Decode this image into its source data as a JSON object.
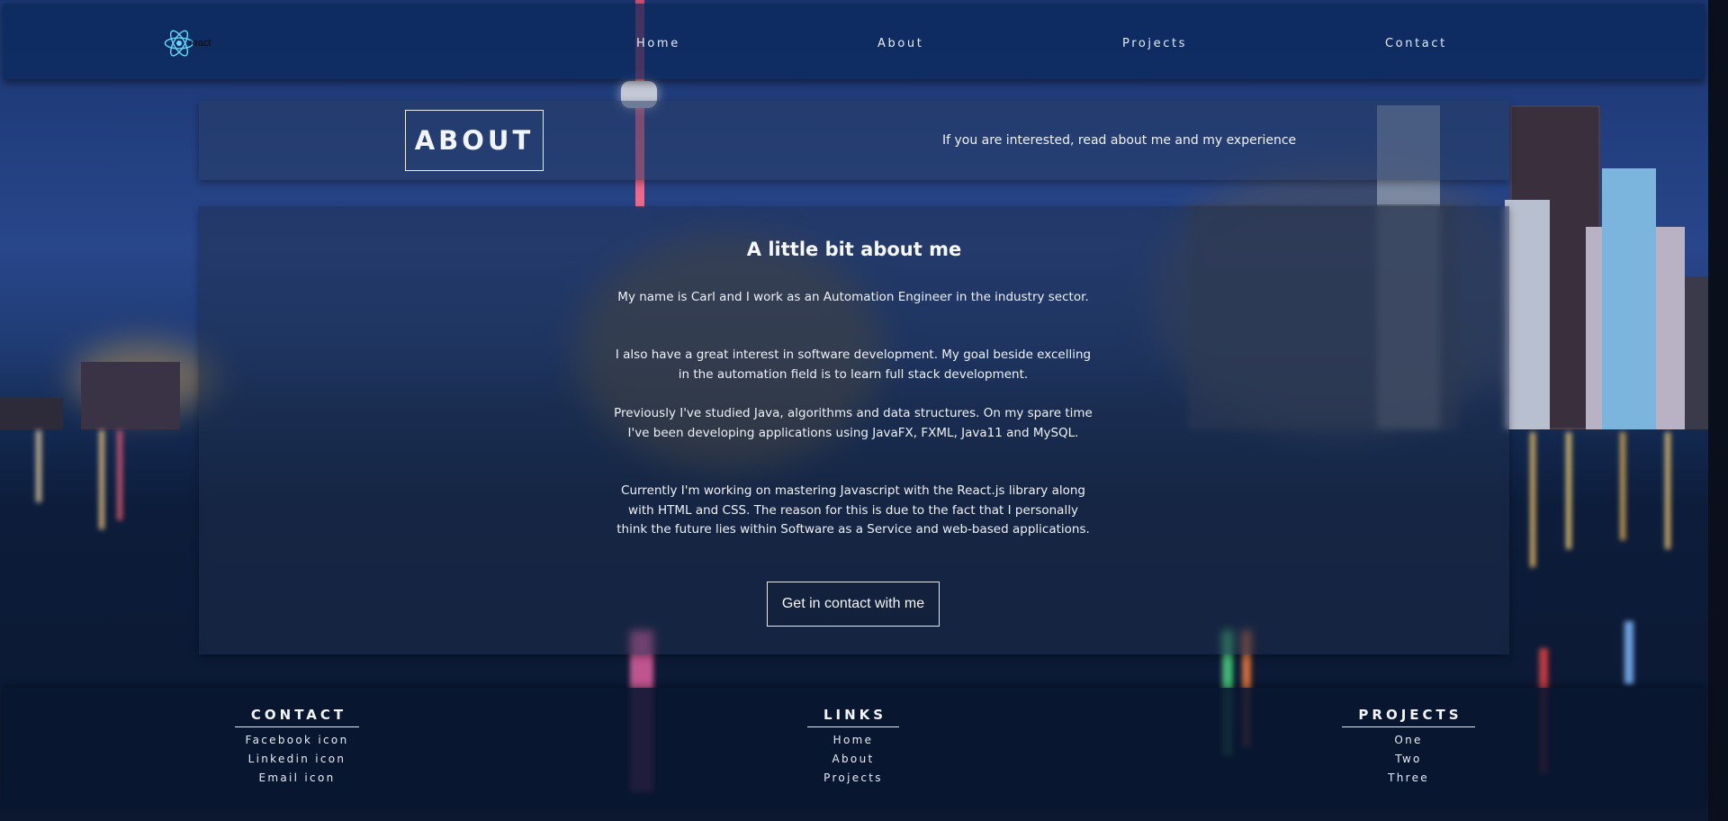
{
  "navbar": {
    "logo_text": "react",
    "links": [
      "Home",
      "About",
      "Projects",
      "Contact"
    ]
  },
  "about_header": {
    "title": "ABOUT",
    "tagline": "If you are interested, read about me and my experience"
  },
  "main": {
    "heading": "A little bit about me",
    "paragraphs": [
      "My name is Carl and I work as an Automation Engineer in the industry sector.",
      "I also have a great interest in software development. My goal beside excelling in the automation field is to learn full stack development.",
      "Previously I've studied Java, algorithms and data structures. On my spare time I've been developing applications using JavaFX, FXML, Java11 and MySQL.",
      "Currently I'm working on mastering Javascript with the React.js library along with HTML and CSS. The reason for this is due to the fact that I personally think the future lies within Software as a Service and web-based applications."
    ],
    "cta_label": "Get in contact with me"
  },
  "footer": {
    "contact": {
      "title": "CONTACT",
      "items": [
        "Facebook icon",
        "Linkedin icon",
        "Email icon"
      ]
    },
    "links": {
      "title": "LINKS",
      "items": [
        "Home",
        "About",
        "Projects"
      ]
    },
    "projects": {
      "title": "PROJECTS",
      "items": [
        "One",
        "Two",
        "Three"
      ]
    }
  },
  "colors": {
    "navbar_bg": "#0a285a",
    "react_logo": "#61dafb",
    "text": "#f2f4f8"
  }
}
